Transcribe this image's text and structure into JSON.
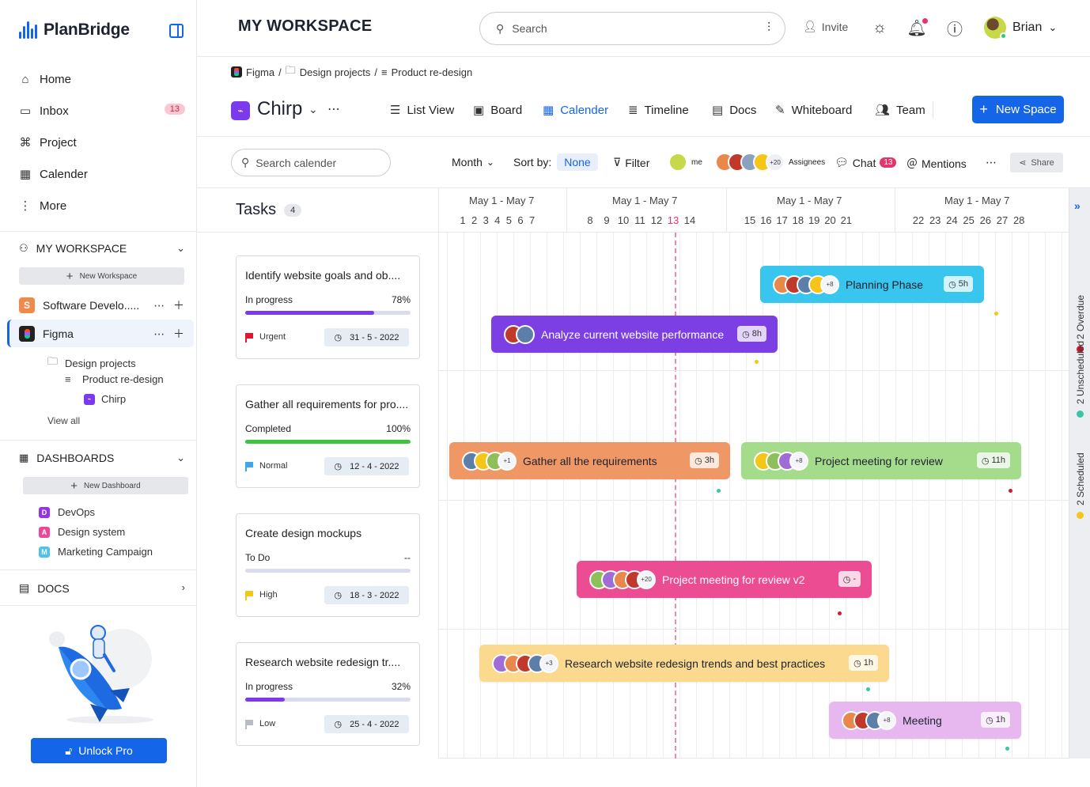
{
  "app": {
    "name": "PlanBridge"
  },
  "sidebar": {
    "nav": [
      {
        "label": "Home",
        "icon": "home-icon"
      },
      {
        "label": "Inbox",
        "icon": "inbox-icon",
        "badge": "13"
      },
      {
        "label": "Project",
        "icon": "command-icon"
      },
      {
        "label": "Calender",
        "icon": "calendar-icon"
      },
      {
        "label": "More",
        "icon": "more-vertical-icon"
      }
    ],
    "workspace": {
      "title": "MY WORKSPACE",
      "new_label": "New Workspace",
      "items": [
        {
          "label": "Software Develo.....",
          "letter": "S",
          "color": "#f08a4b"
        },
        {
          "label": "Figma",
          "letter": "",
          "color": "#222222"
        }
      ],
      "tree": {
        "folder": "Design projects",
        "list": "Product re-design",
        "space": "Chirp"
      },
      "view_all": "View all"
    },
    "dashboards": {
      "title": "DASHBOARDS",
      "new_label": "New Dashboard",
      "items": [
        {
          "label": "DevOps",
          "letter": "D",
          "color": "#9333ea"
        },
        {
          "label": "Design system",
          "letter": "A",
          "color": "#ec4899"
        },
        {
          "label": "Marketing Campaign",
          "letter": "M",
          "color": "#4fc3e8"
        }
      ]
    },
    "docs": {
      "title": "DOCS"
    },
    "unlock_label": "Unlock Pro"
  },
  "header": {
    "title": "MY WORKSPACE",
    "search_placeholder": "Search",
    "invite_label": "Invite",
    "user_name": "Brian"
  },
  "breadcrumb": {
    "workspace": "Figma",
    "folder": "Design projects",
    "list": "Product re-design",
    "sep": "/"
  },
  "project": {
    "name": "Chirp",
    "views": [
      {
        "label": "List View",
        "icon": "list-icon"
      },
      {
        "label": "Board",
        "icon": "board-icon"
      },
      {
        "label": "Calender",
        "icon": "calendar-icon",
        "active": true
      },
      {
        "label": "Timeline",
        "icon": "timeline-icon"
      },
      {
        "label": "Docs",
        "icon": "docs-icon"
      },
      {
        "label": "Whiteboard",
        "icon": "whiteboard-icon"
      },
      {
        "label": "Team",
        "icon": "team-icon"
      }
    ],
    "new_space_label": "New Space"
  },
  "toolbar": {
    "search_placeholder": "Search calender",
    "month_label": "Month",
    "sort_label": "Sort by:",
    "sort_value": "None",
    "filter_label": "Filter",
    "me_label": "me",
    "assignees_more": "+20",
    "assignees_label": "Assignees",
    "chat_label": "Chat",
    "chat_count": "13",
    "mentions_label": "Mentions",
    "share_label": "Share"
  },
  "tasks": {
    "title": "Tasks",
    "count": "4",
    "items": [
      {
        "title": "Identify website goals and ob....",
        "status": "In progress",
        "pct": "78%",
        "progress": 0.78,
        "bar_color": "#7c3aed",
        "priority": "Urgent",
        "flag_color": "#e8142c",
        "date": "31 - 5 - 2022"
      },
      {
        "title": "Gather all requirements for pro....",
        "status": "Completed",
        "pct": "100%",
        "progress": 1.0,
        "bar_color": "#3ec43e",
        "priority": "Normal",
        "flag_color": "#3aa7f0",
        "date": "12 - 4 - 2022"
      },
      {
        "title": "Create design mockups",
        "status": "To Do",
        "pct": "--",
        "progress": 0.0,
        "bar_color": "#7c3aed",
        "priority": "High",
        "flag_color": "#f5c518",
        "date": "18 - 3 - 2022"
      },
      {
        "title": "Research website redesign tr....",
        "status": "In progress",
        "pct": "32%",
        "progress": 0.24,
        "bar_color": "#7c3aed",
        "priority": "Low",
        "flag_color": "#b7bcc5",
        "date": "25 - 4 - 2022"
      }
    ]
  },
  "calendar": {
    "weeks": [
      {
        "label": "May 1 - May 7",
        "days": [
          "1",
          "2",
          "3",
          "4",
          "5",
          "6",
          "7"
        ]
      },
      {
        "label": "May 1 - May 7",
        "days": [
          "8",
          "9",
          "10",
          "11",
          "12",
          "13",
          "14"
        ]
      },
      {
        "label": "May 1 - May 7",
        "days": [
          "15",
          "16",
          "17",
          "18",
          "19",
          "20",
          "21"
        ]
      },
      {
        "label": "May 1 - May 7",
        "days": [
          "22",
          "23",
          "24",
          "25",
          "26",
          "27",
          "28"
        ]
      }
    ],
    "today": "13",
    "events": [
      {
        "title": "Planning Phase",
        "time": "5h",
        "more": "+8",
        "color": "#39c6ee",
        "text_color": "#1c2230"
      },
      {
        "title": "Analyze current website performance",
        "time": "8h",
        "more": "",
        "color": "#7b3fe4",
        "text_color": "#ffffff"
      },
      {
        "title": "Gather all the requirements",
        "time": "3h",
        "more": "+1",
        "color": "#ef9866",
        "text_color": "#1c2230"
      },
      {
        "title": "Project meeting for review",
        "time": "11h",
        "more": "+8",
        "color": "#a5dc8c",
        "text_color": "#1c2230"
      },
      {
        "title": "Project meeting for review v2",
        "time": "-",
        "more": "+20",
        "color": "#ec4c92",
        "text_color": "#ffffff"
      },
      {
        "title": "Research website redesign trends and best practices",
        "time": "1h",
        "more": "+3",
        "color": "#fbd98e",
        "text_color": "#1c2230"
      },
      {
        "title": "Meeting",
        "time": "1h",
        "more": "+8",
        "color": "#e7b8f0",
        "text_color": "#1c2230"
      }
    ]
  },
  "rail": {
    "overdue": "2 Overdue",
    "unscheduled": "2 Unscheduled",
    "scheduled": "2 Scheduled"
  },
  "colors": {
    "accent": "#1565e8",
    "today": "#e5336b",
    "overdue": "#d81b2c",
    "unscheduled": "#3cc4a4",
    "scheduled": "#f5c518"
  }
}
